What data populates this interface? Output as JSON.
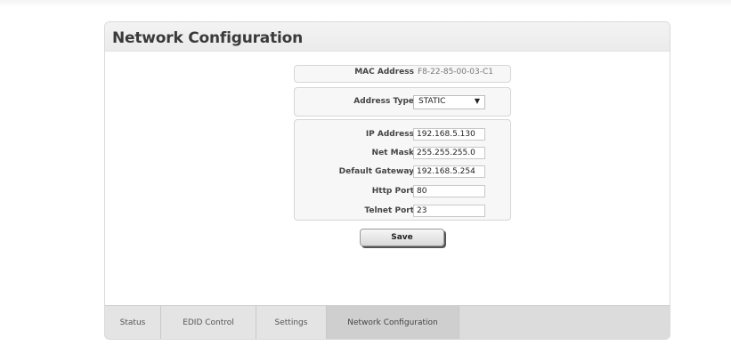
{
  "panel": {
    "title": "Network Configuration"
  },
  "mac": {
    "label": "MAC Address",
    "value": "F8-22-85-00-03-C1"
  },
  "address_type": {
    "label": "Address Type",
    "selected": "STATIC"
  },
  "fields": [
    {
      "label": "IP Address",
      "value": "192.168.5.130"
    },
    {
      "label": "Net Mask",
      "value": "255.255.255.0"
    },
    {
      "label": "Default Gateway",
      "value": "192.168.5.254"
    },
    {
      "label": "Http Port",
      "value": "80"
    },
    {
      "label": "Telnet Port",
      "value": "23"
    }
  ],
  "save_label": "Save",
  "tabs": [
    {
      "label": "Status"
    },
    {
      "label": "EDID Control"
    },
    {
      "label": "Settings"
    },
    {
      "label": "Network Configuration",
      "active": true
    }
  ]
}
